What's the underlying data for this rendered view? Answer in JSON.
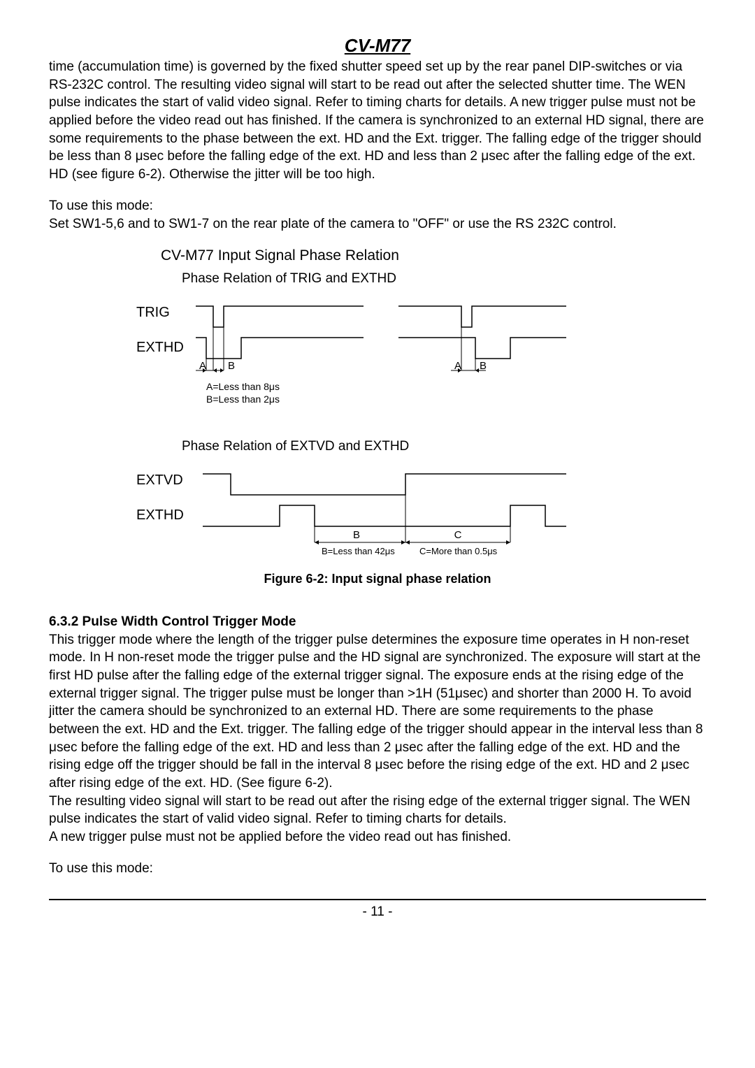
{
  "header": {
    "title": "CV-M77"
  },
  "paragraphs": {
    "p1": "time (accumulation time) is governed by the fixed shutter speed set up by the rear panel DIP-switches or via RS-232C control. The resulting video signal will start to be read out after the selected shutter time. The WEN pulse indicates the start of valid video signal. Refer to timing charts for details. A new trigger pulse must not be applied before the video read out has finished. If the camera is synchronized to an external HD signal, there are some requirements to the phase between the ext. HD and the Ext. trigger. The falling edge of the trigger should be less than 8 μsec before the falling edge of the ext. HD and less than 2 μsec after the falling edge of the ext. HD (see figure 6-2). Otherwise the jitter will be too high.",
    "p2a": "To use this mode:",
    "p2b": "Set SW1-5,6 and to SW1-7 on the rear plate of the camera to \"OFF\" or use the RS 232C control."
  },
  "diagram": {
    "title": "CV-M77 Input Signal Phase Relation",
    "sub1": "Phase Relation of TRIG and EXTHD",
    "sub2": "Phase Relation of EXTVD and EXTHD",
    "labels": {
      "trig": "TRIG",
      "exthd": "EXTHD",
      "extvd": "EXTVD",
      "a": "A",
      "b": "B",
      "c": "C",
      "note_a": "A=Less than 8μs",
      "note_b": "B=Less than 2μs",
      "note_b2": "B=Less than 42μs",
      "note_c": "C=More than 0.5μs"
    },
    "caption": "Figure 6-2:  Input signal phase relation"
  },
  "section632": {
    "head": "6.3.2   Pulse Width Control Trigger Mode",
    "body1": "This trigger mode where the length of the trigger pulse determines the exposure time operates in H non-reset mode. In H non-reset mode the trigger pulse and the HD signal are synchronized. The exposure will start at the first HD pulse after the falling edge of the external trigger signal. The exposure ends at the rising edge of the external trigger signal. The trigger pulse must be longer than >1H (51μsec) and shorter than 2000 H. To avoid jitter the camera should be synchronized to an external HD. There are some requirements to the phase between the ext. HD and the Ext. trigger. The falling edge of the trigger should appear in the interval less than 8 μsec before the falling edge of the ext. HD and less than 2 μsec after the falling edge of the ext. HD and the rising edge off the trigger should be fall in the interval 8 μsec before the rising edge of the ext. HD and 2 μsec after rising edge of the ext. HD. (See figure 6-2).",
    "body2": "The resulting video signal will start to be read out after the rising edge of the external trigger signal. The WEN pulse indicates the start of valid video signal. Refer to timing charts for details.",
    "body3": "A new trigger pulse must not be applied before the video read out has finished.",
    "body4": "To use this mode:"
  },
  "footer": {
    "page": "- 11 -"
  }
}
